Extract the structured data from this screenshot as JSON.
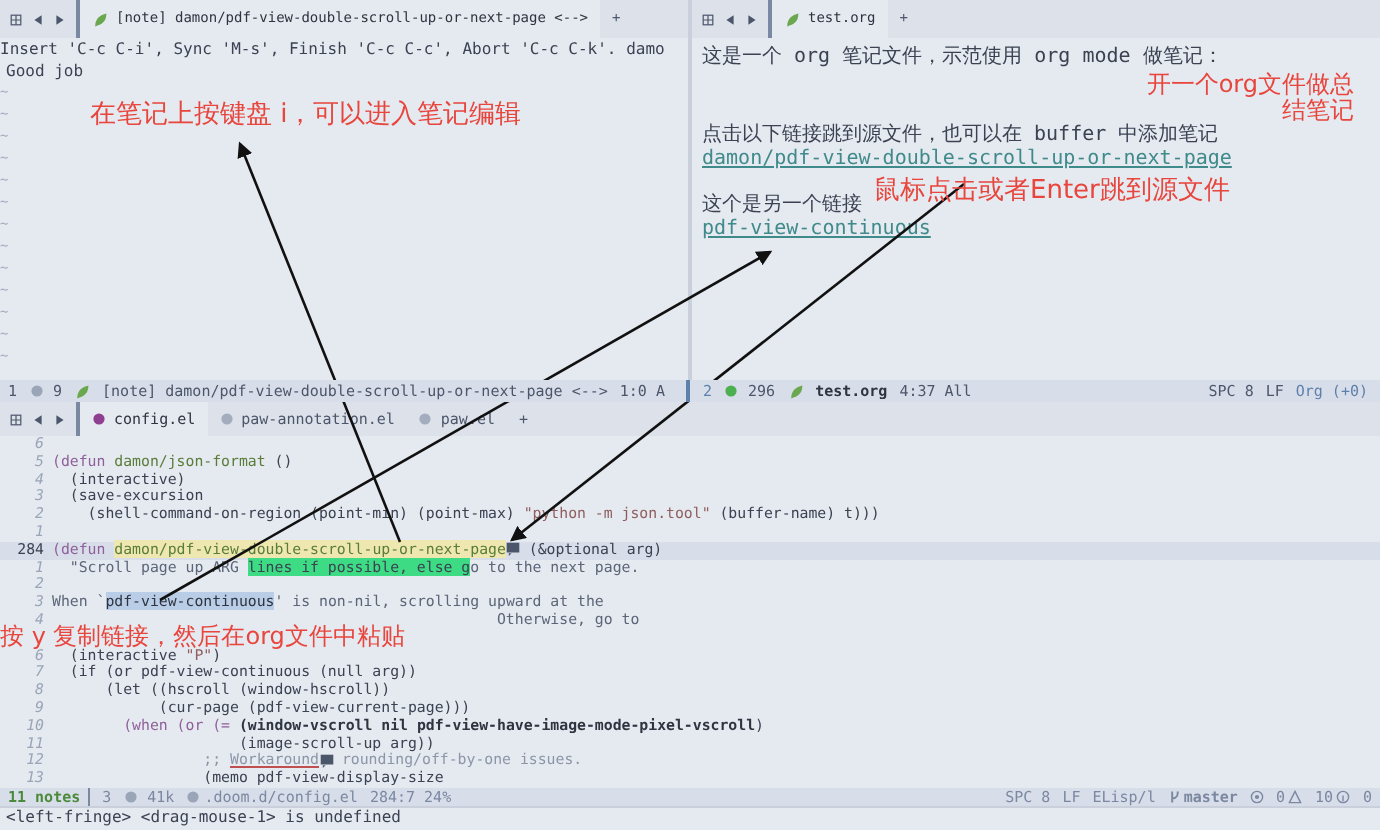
{
  "left_pane": {
    "tabs": [
      {
        "label": "[note] damon/pdf-view-double-scroll-up-or-next-page <-->",
        "selected": true
      }
    ],
    "new_tab": "+",
    "lines": [
      "Insert 'C-c C-i', Sync 'M-s', Finish 'C-c C-c', Abort 'C-c C-k'. damo",
      "Good job"
    ],
    "fringe": [
      "~",
      "~",
      "~",
      "~",
      "~",
      "~",
      "~",
      "~",
      "~",
      "~",
      "~",
      "~",
      "~"
    ]
  },
  "right_pane": {
    "tabs": [
      {
        "label": "test.org",
        "selected": true
      }
    ],
    "new_tab": "+",
    "lines": [
      {
        "kind": "text",
        "text": "这是一个 org 笔记文件，示范使用 org mode 做笔记："
      },
      {
        "kind": "blank"
      },
      {
        "kind": "text",
        "text": "点击以下链接跳到源文件，也可以在 buffer 中添加笔记"
      },
      {
        "kind": "link",
        "text": "damon/pdf-view-double-scroll-up-or-next-page"
      },
      {
        "kind": "blank"
      },
      {
        "kind": "text",
        "text": "这个是另一个链接"
      },
      {
        "kind": "link",
        "text": "pdf-view-continuous"
      }
    ]
  },
  "modeline_top_left": {
    "window_number": "1",
    "size": "9",
    "buffer": "[note] damon/pdf-view-double-scroll-up-or-next-page <-->",
    "position": "1:0 A"
  },
  "modeline_top_right": {
    "window_number": "2",
    "size": "296",
    "buffer": "test.org",
    "position": "4:37 All",
    "indent": "SPC 8",
    "eol": "LF",
    "mode": "Org (+0)"
  },
  "bottom_tabs": [
    {
      "label": "config.el",
      "selected": true
    },
    {
      "label": "paw-annotation.el",
      "selected": false
    },
    {
      "label": "paw.el",
      "selected": false
    }
  ],
  "bottom_new_tab": "+",
  "code": [
    {
      "num": "6",
      "current": false
    },
    {
      "num": "5",
      "current": false,
      "segments": [
        {
          "kind": "keyword",
          "text": "(defun "
        },
        {
          "kind": "name",
          "text": "damon/json-format"
        },
        {
          "kind": "plain",
          "text": " ()"
        }
      ]
    },
    {
      "num": "4",
      "current": false,
      "segments": [
        {
          "kind": "plain",
          "text": "  (interactive)"
        }
      ]
    },
    {
      "num": "3",
      "current": false,
      "segments": [
        {
          "kind": "plain",
          "text": "  (save-excursion"
        }
      ]
    },
    {
      "num": "2",
      "current": false,
      "segments": [
        {
          "kind": "plain",
          "text": "    (shell-command-on-region (point-min) (point-max) "
        },
        {
          "kind": "string",
          "text": "\"python -m json.tool\""
        },
        {
          "kind": "plain",
          "text": " (buffer-name) t)))"
        }
      ]
    },
    {
      "num": "1",
      "current": false
    },
    {
      "num": "284",
      "current": true,
      "segments": [
        {
          "kind": "keyword",
          "text": "(defun "
        },
        {
          "kind": "name",
          "text": "damon/pdf-view-double-scroll-up-or-next-page"
        },
        {
          "kind": "note"
        },
        {
          "kind": "plain",
          "text": " (&optional arg)"
        }
      ]
    },
    {
      "num": "1",
      "current": false,
      "segments": [
        {
          "kind": "doc",
          "text": "  \"Scroll page up ARG "
        },
        {
          "kind": "match",
          "text": "lines if possible, else g"
        },
        {
          "kind": "doc",
          "text": "o to the next page."
        }
      ]
    },
    {
      "num": "2",
      "current": false
    },
    {
      "num": "3",
      "current": false,
      "segments": [
        {
          "kind": "doc",
          "text": "When `"
        },
        {
          "kind": "region",
          "text": "pdf-view-continuous"
        },
        {
          "kind": "doc",
          "text": "' is non-nil, scrolling upward at the"
        }
      ]
    },
    {
      "num": "4",
      "current": false,
      "segments": [
        {
          "kind": "tail",
          "text": "Otherwise, go to"
        }
      ]
    },
    {
      "current": false
    },
    {
      "num": "6",
      "current": false,
      "segments": [
        {
          "kind": "plain",
          "text": "  (interactive "
        },
        {
          "kind": "string",
          "text": "\"P\""
        },
        {
          "kind": "plain",
          "text": ")"
        }
      ]
    },
    {
      "num": "7",
      "current": false,
      "segments": [
        {
          "kind": "plain",
          "text": "  (if (or pdf-view-continuous (null arg))"
        }
      ]
    },
    {
      "num": "8",
      "current": false,
      "segments": [
        {
          "kind": "plain",
          "text": "      (let ((hscroll (window-hscroll))"
        }
      ]
    },
    {
      "num": "9",
      "current": false,
      "segments": [
        {
          "kind": "plain",
          "text": "            (cur-page (pdf-view-current-page)))"
        }
      ]
    },
    {
      "num": "10",
      "current": false,
      "segments": [
        {
          "kind": "keyword",
          "text": "        (when (or (= "
        },
        {
          "kind": "strong",
          "text": "(window-vscroll nil pdf-view-have-image-mode-pixel-vscroll"
        },
        {
          "kind": "plain",
          "text": ")"
        }
      ]
    },
    {
      "num": "11",
      "current": false,
      "segments": [
        {
          "kind": "plain",
          "text": "                     (image-scroll-up arg))"
        }
      ]
    },
    {
      "num": "12",
      "current": false,
      "segments": [
        {
          "kind": "comment",
          "text": "                 ;; "
        },
        {
          "kind": "misspelled",
          "text": "Workaround"
        },
        {
          "kind": "note"
        },
        {
          "kind": "comment",
          "text": " rounding/off-by-one issues."
        }
      ]
    },
    {
      "num": "13",
      "current": false,
      "segments": [
        {
          "kind": "plain",
          "text": "                 (memo pdf-view-display-size"
        }
      ]
    }
  ],
  "modeline_bottom": {
    "notes": "11 notes",
    "window_number": "3",
    "size": "41k",
    "buffer": ".doom.d/config.el",
    "position": "284:7 24%",
    "indent": "SPC 8",
    "eol": "LF",
    "mode": "ELisp/l",
    "branch": "master",
    "errors": "0",
    "warnings": "10",
    "infos": "0"
  },
  "echo_area": "<left-fringe> <drag-mouse-1> is undefined",
  "annotations": [
    {
      "kind": "note",
      "text": "在笔记上按键盘 i，可以进入笔记编辑"
    },
    {
      "kind": "summary",
      "text": "开一个org文件做总结笔记"
    },
    {
      "kind": "jump",
      "text": "鼠标点击或者Enter跳到源文件"
    },
    {
      "kind": "copy",
      "text": "按  y 复制链接，然后在org文件中粘贴"
    }
  ]
}
